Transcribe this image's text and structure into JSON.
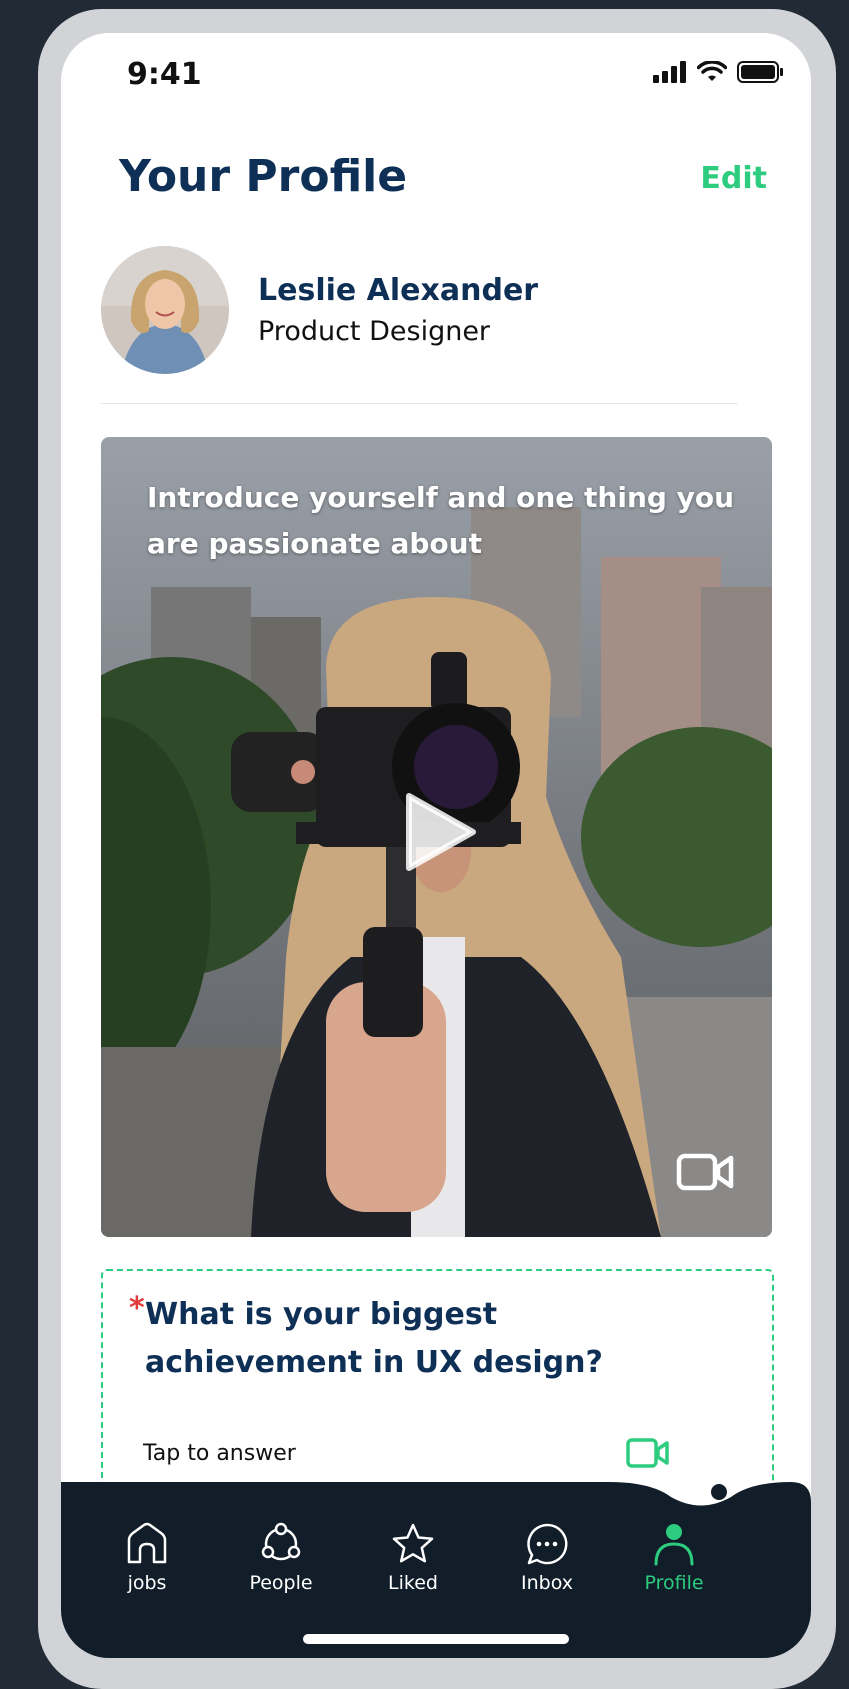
{
  "status_bar": {
    "time": "9:41"
  },
  "header": {
    "title": "Your Profile",
    "edit_label": "Edit"
  },
  "profile": {
    "name": "Leslie Alexander",
    "role": "Product Designer"
  },
  "video_card": {
    "prompt": "Introduce yourself and one thing you are passionate about"
  },
  "question_card": {
    "required_marker": "*",
    "question": "What is your biggest achievement in UX design?",
    "answer_prompt": "Tap to answer"
  },
  "tab_bar": {
    "items": [
      {
        "label": "jobs",
        "icon": "home-icon"
      },
      {
        "label": "People",
        "icon": "people-icon"
      },
      {
        "label": "Liked",
        "icon": "star-icon"
      },
      {
        "label": "Inbox",
        "icon": "chat-icon"
      },
      {
        "label": "Profile",
        "icon": "profile-icon"
      }
    ],
    "active_index": 4
  },
  "colors": {
    "primary": "#0e2f56",
    "accent": "#2dcc7f",
    "tab_bar_background": "#111e29",
    "required": "#e23b3b"
  }
}
